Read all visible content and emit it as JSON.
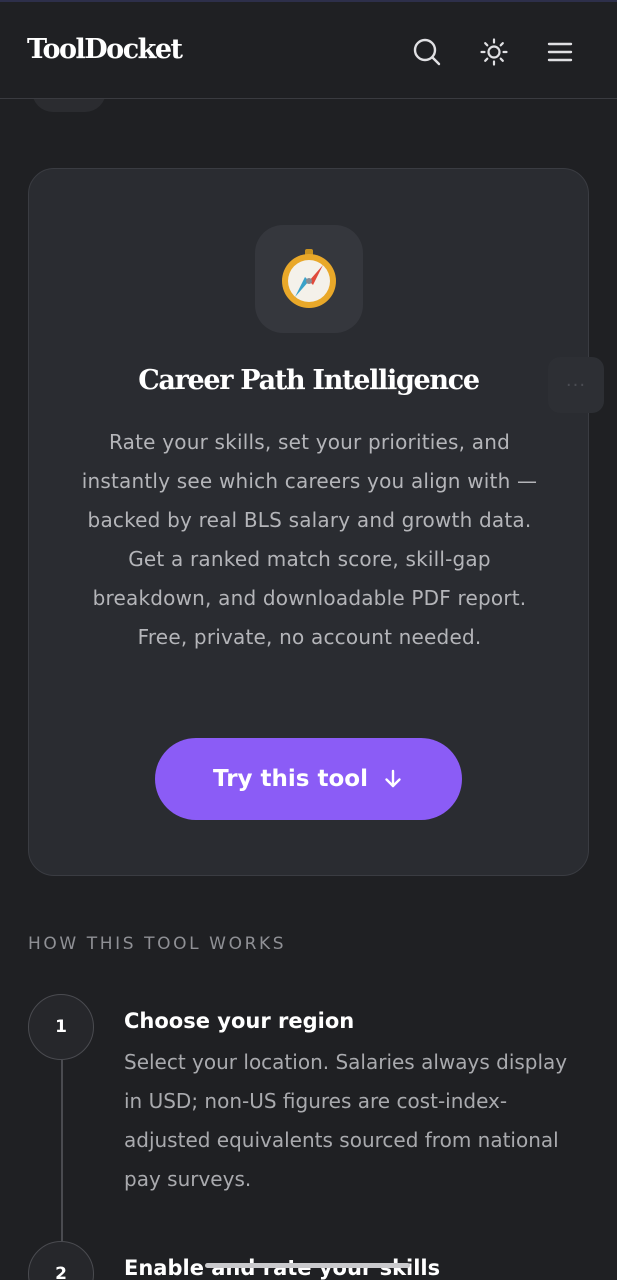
{
  "header": {
    "logo": "ToolDocket",
    "icons": [
      "search-icon",
      "sun-icon",
      "menu-icon"
    ]
  },
  "card": {
    "icon": "compass-icon",
    "title": "Career Path Intelligence",
    "description": "Rate your skills, set your priorities, and instantly see which careers you align with — backed by real BLS salary and growth data. Get a ranked match score, skill-gap breakdown, and downloadable PDF report. Free, private, no account needed.",
    "button_label": "Try this tool",
    "button_icon": "arrow-down-icon",
    "accent": "#8b5cf6"
  },
  "how_it_works": {
    "label": "HOW THIS TOOL WORKS",
    "steps": [
      {
        "number": "1",
        "title": "Choose your region",
        "description": "Select your location. Salaries always display in USD; non-US figures are cost-index-adjusted equivalents sourced from national pay surveys."
      },
      {
        "number": "2",
        "title": "Enable and rate your skills",
        "description": ""
      }
    ]
  }
}
